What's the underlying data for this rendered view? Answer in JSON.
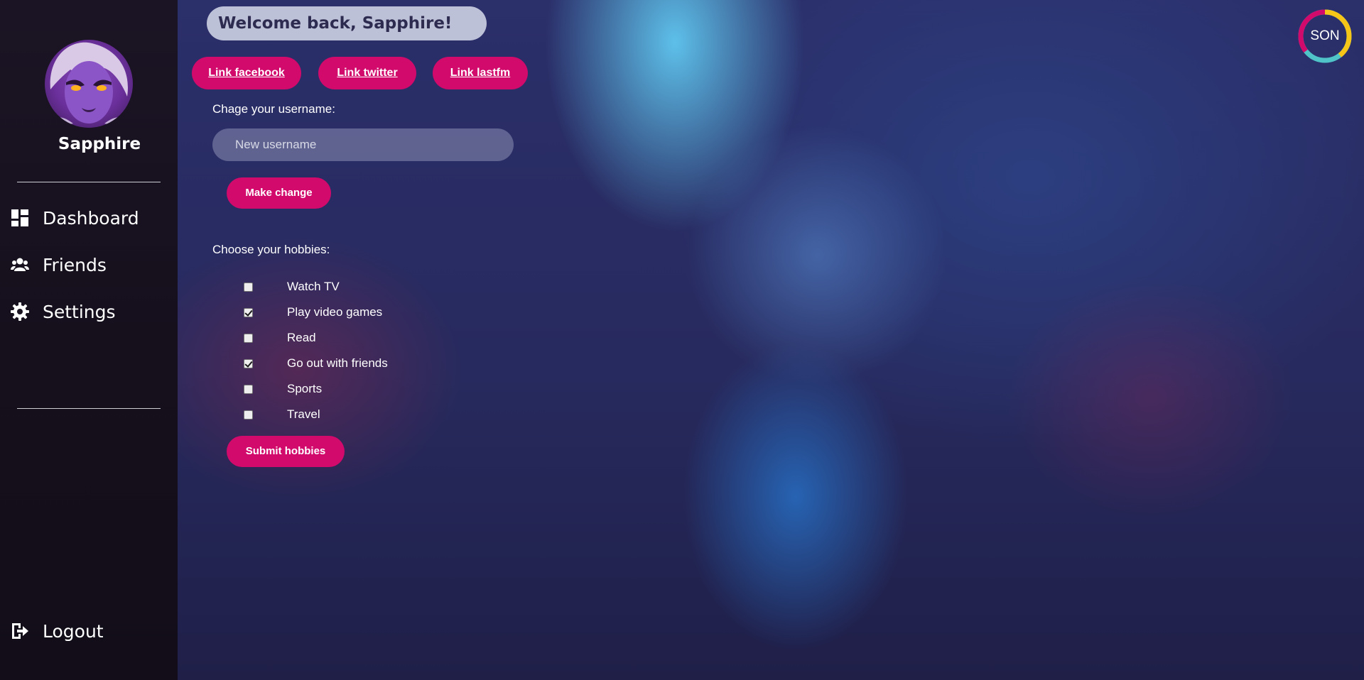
{
  "sidebar": {
    "username": "Sapphire",
    "nav": [
      {
        "label": "Dashboard",
        "icon": "dashboard-icon"
      },
      {
        "label": "Friends",
        "icon": "friends-icon"
      },
      {
        "label": "Settings",
        "icon": "gear-icon"
      }
    ],
    "logout": {
      "label": "Logout",
      "icon": "logout-icon"
    }
  },
  "header": {
    "welcome": "Welcome back, Sapphire!"
  },
  "links": [
    {
      "label": "Link facebook"
    },
    {
      "label": "Link twitter"
    },
    {
      "label": "Link lastfm"
    }
  ],
  "username_form": {
    "label": "Chage your username:",
    "placeholder": "New username",
    "value": "",
    "button": "Make change"
  },
  "hobbies": {
    "label": "Choose your hobbies:",
    "items": [
      {
        "label": "Watch TV",
        "checked": false
      },
      {
        "label": "Play video games",
        "checked": true
      },
      {
        "label": "Read",
        "checked": false
      },
      {
        "label": "Go out with friends",
        "checked": true
      },
      {
        "label": "Sports",
        "checked": false
      },
      {
        "label": "Travel",
        "checked": false
      }
    ],
    "button": "Submit hobbies"
  },
  "logo": {
    "text": "SON"
  },
  "colors": {
    "accent": "#d10a6c",
    "sidebar_bg": "#1a1322",
    "logo_ring": [
      "#d10a6c",
      "#f5c518",
      "#4fc3c8"
    ]
  }
}
